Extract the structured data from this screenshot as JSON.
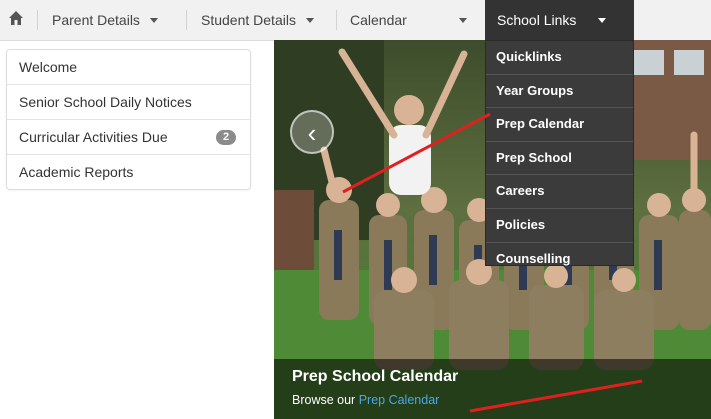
{
  "nav": {
    "home_icon": "home-icon",
    "items": [
      {
        "label": "Parent Details"
      },
      {
        "label": "Student Details"
      },
      {
        "label": "Calendar"
      },
      {
        "label": "School Links"
      }
    ]
  },
  "sidebar": {
    "items": [
      {
        "label": "Welcome"
      },
      {
        "label": "Senior School Daily Notices"
      },
      {
        "label": "Curricular Activities Due",
        "badge": "2"
      },
      {
        "label": "Academic Reports"
      }
    ]
  },
  "dropdown": {
    "items": [
      {
        "label": "Quicklinks"
      },
      {
        "label": "Year Groups"
      },
      {
        "label": "Prep Calendar"
      },
      {
        "label": "Prep School"
      },
      {
        "label": "Careers"
      },
      {
        "label": "Policies"
      },
      {
        "label": "Counselling"
      }
    ]
  },
  "hero": {
    "prev_icon": "chevron-left-icon",
    "caption_title": "Prep School Calendar",
    "caption_prefix": "Browse our ",
    "caption_link": "Prep Calendar"
  },
  "colors": {
    "active_nav": "#333333",
    "dropdown_bg": "#3b3b3b",
    "link": "#49a8e8",
    "annotation": "#e02020"
  }
}
